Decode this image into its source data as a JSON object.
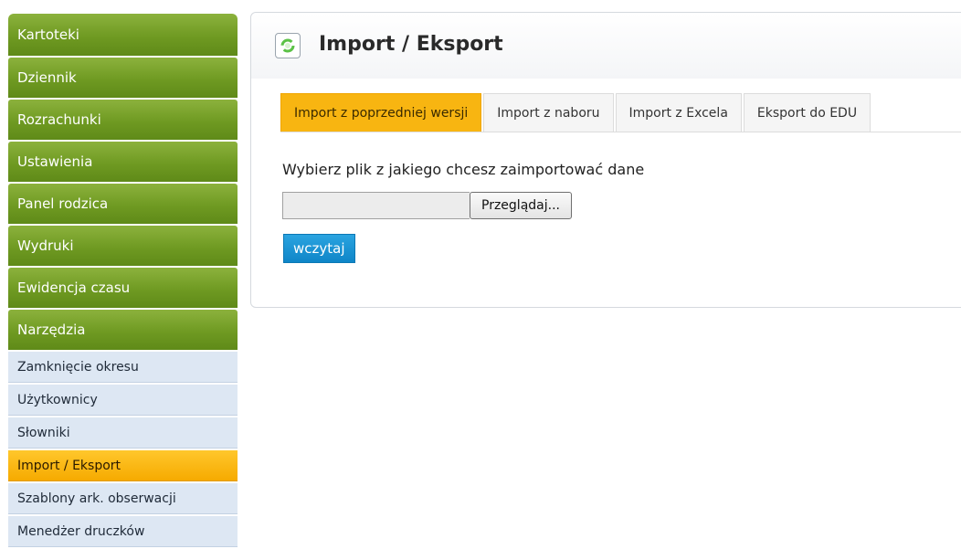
{
  "sidebar": {
    "main_items": [
      {
        "label": "Kartoteki"
      },
      {
        "label": "Dziennik"
      },
      {
        "label": "Rozrachunki"
      },
      {
        "label": "Ustawienia"
      },
      {
        "label": "Panel rodzica"
      },
      {
        "label": "Wydruki"
      },
      {
        "label": "Ewidencja czasu"
      },
      {
        "label": "Narzędzia"
      }
    ],
    "sub_items": [
      {
        "label": "Zamknięcie okresu"
      },
      {
        "label": "Użytkownicy"
      },
      {
        "label": "Słowniki"
      },
      {
        "label": "Import / Eksport",
        "active": true
      },
      {
        "label": "Szablony ark. obserwacji"
      },
      {
        "label": "Menedżer druczków"
      }
    ]
  },
  "header": {
    "title": "Import / Eksport",
    "icon": "refresh-icon"
  },
  "tabs": [
    {
      "label": "Import z poprzedniej wersji",
      "active": true
    },
    {
      "label": "Import z naboru"
    },
    {
      "label": "Import z Excela"
    },
    {
      "label": "Eksport do EDU"
    }
  ],
  "form": {
    "prompt": "Wybierz plik z jakiego chcesz zaimportować dane",
    "file_value": "",
    "browse_label": "Przeglądaj...",
    "load_label": "wczytaj"
  },
  "colors": {
    "nav_green": "#6f9a22",
    "active_orange": "#f8b511",
    "sub_blue": "#dde7f3",
    "button_blue": "#0f86c8"
  }
}
